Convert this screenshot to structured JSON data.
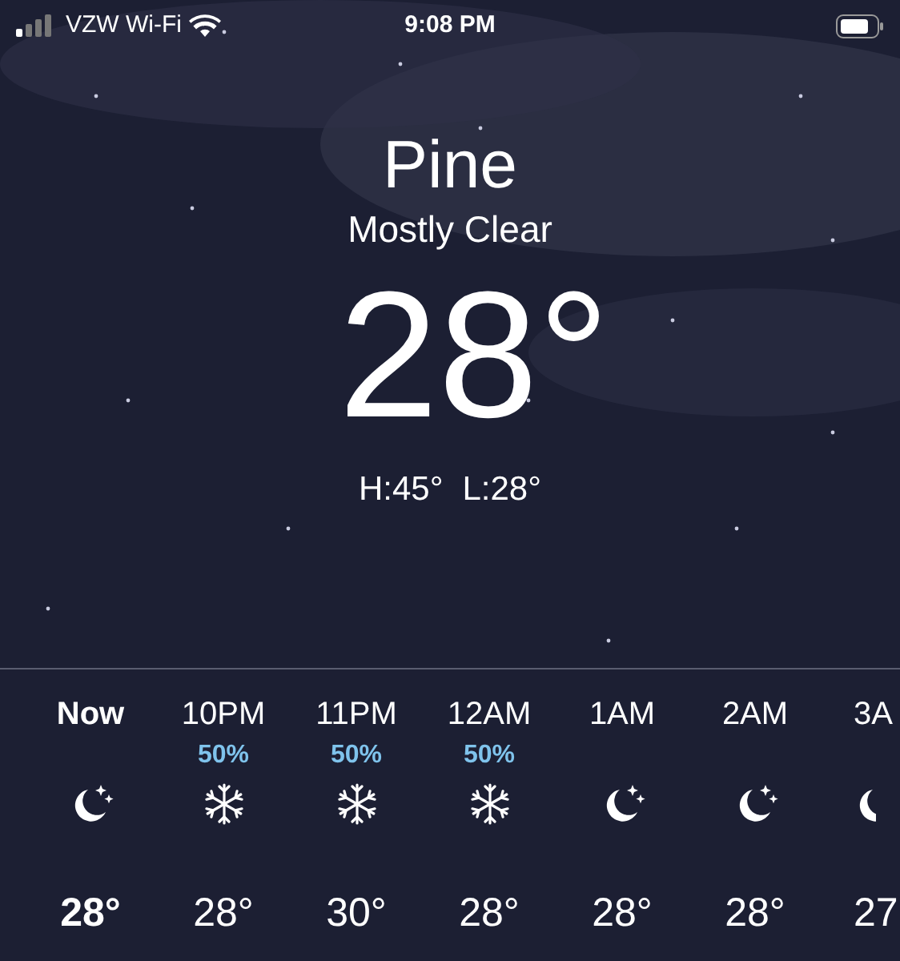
{
  "status_bar": {
    "carrier": "VZW Wi-Fi",
    "time": "9:08 PM"
  },
  "location": "Pine",
  "condition": "Mostly Clear",
  "temperature": "28°",
  "high": "H:45°",
  "low": "L:28°",
  "hourly": [
    {
      "time": "Now",
      "kind": "moon",
      "temp": "28°",
      "current": true
    },
    {
      "time": "10PM",
      "precipitation": "50%",
      "kind": "snow",
      "temp": "28°",
      "current": false
    },
    {
      "time": "11PM",
      "precipitation": "50%",
      "kind": "snow",
      "temp": "30°",
      "current": false
    },
    {
      "time": "12AM",
      "precipitation": "50%",
      "kind": "snow",
      "temp": "28°",
      "current": false
    },
    {
      "time": "1AM",
      "kind": "moon",
      "temp": "28°",
      "current": false
    },
    {
      "time": "2AM",
      "kind": "moon",
      "temp": "28°",
      "current": false
    },
    {
      "time": "3A",
      "kind": "moon",
      "temp": "27",
      "current": false
    }
  ]
}
